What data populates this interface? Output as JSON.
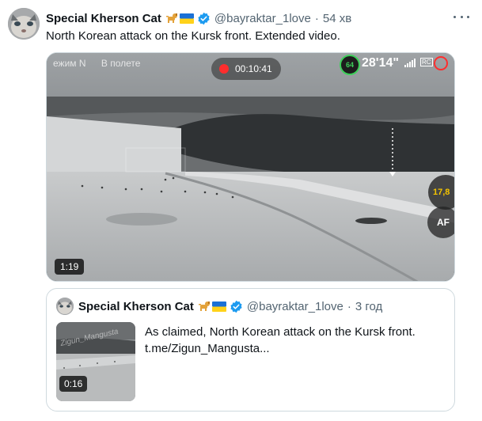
{
  "tweet": {
    "author_name": "Special Kherson Cat",
    "handle": "@bayraktar_1love",
    "separator": "·",
    "time": "54 хв",
    "text": "North Korean attack on the Kursk front. Extended video.",
    "media": {
      "osd_mode": "ежим N",
      "osd_flight": "В полете",
      "rec_time": "00:10:41",
      "battery": "64",
      "flight_time": "28'14\"",
      "rc_label": "RC",
      "speed": "17,8",
      "af_label": "AF",
      "duration": "1:19"
    }
  },
  "quoted": {
    "author_name": "Special Kherson Cat",
    "handle": "@bayraktar_1love",
    "separator": "·",
    "time": "3 год",
    "text_line1": "As claimed, North Korean attack on the Kursk front.",
    "text_line2": "t.me/Zigun_Mangusta...",
    "thumb_watermark": "Zigun_Mangusta",
    "duration": "0:16"
  },
  "colors": {
    "verified": "#1d9bf0",
    "text": "#0f1419",
    "secondary": "#536471",
    "border": "#cfd9de"
  },
  "icons": [
    "avatar",
    "dog-emoji",
    "ukraine-flag-emoji",
    "verified-badge-icon",
    "more-options-icon"
  ]
}
